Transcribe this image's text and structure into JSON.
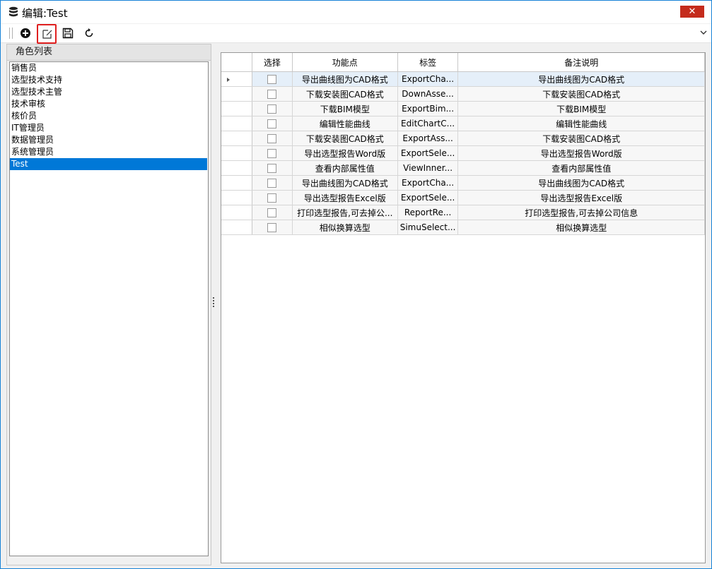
{
  "window": {
    "title": "编辑:Test",
    "icon": "database-icon",
    "close_label": "✕"
  },
  "toolbar": {
    "buttons": [
      {
        "name": "add",
        "icon": "plus-circle-icon"
      },
      {
        "name": "edit",
        "icon": "edit-icon",
        "highlighted": true
      },
      {
        "name": "save",
        "icon": "save-icon"
      },
      {
        "name": "refresh",
        "icon": "refresh-icon"
      }
    ],
    "overflow_icon": "chevron-down-icon"
  },
  "left_panel": {
    "header": "角色列表",
    "roles": [
      "销售员",
      "选型技术支持",
      "选型技术主管",
      "技术审核",
      "核价员",
      "IT管理员",
      "数据管理员",
      "系统管理员",
      "Test"
    ],
    "selected_index": 8
  },
  "grid": {
    "columns": [
      "选择",
      "功能点",
      "标签",
      "备注说明"
    ],
    "rows": [
      {
        "checked": false,
        "feature": "导出曲线图为CAD格式",
        "tag": "ExportCha...",
        "note": "导出曲线图为CAD格式"
      },
      {
        "checked": false,
        "feature": "下载安装图CAD格式",
        "tag": "DownAsse...",
        "note": "下载安装图CAD格式"
      },
      {
        "checked": false,
        "feature": "下载BIM模型",
        "tag": "ExportBim...",
        "note": "下载BIM模型"
      },
      {
        "checked": false,
        "feature": "编辑性能曲线",
        "tag": "EditChartC...",
        "note": "编辑性能曲线"
      },
      {
        "checked": false,
        "feature": "下载安装图CAD格式",
        "tag": "ExportAss...",
        "note": "下载安装图CAD格式"
      },
      {
        "checked": false,
        "feature": "导出选型报告Word版",
        "tag": "ExportSele...",
        "note": "导出选型报告Word版"
      },
      {
        "checked": false,
        "feature": "查看内部属性值",
        "tag": "ViewInner...",
        "note": "查看内部属性值"
      },
      {
        "checked": false,
        "feature": "导出曲线图为CAD格式",
        "tag": "ExportCha...",
        "note": "导出曲线图为CAD格式"
      },
      {
        "checked": false,
        "feature": "导出选型报告Excel版",
        "tag": "ExportSele...",
        "note": "导出选型报告Excel版"
      },
      {
        "checked": false,
        "feature": "打印选型报告,可去掉公...",
        "tag": "ReportRe...",
        "note": "打印选型报告,可去掉公司信息"
      },
      {
        "checked": false,
        "feature": "相似换算选型",
        "tag": "SimuSelect...",
        "note": "相似换算选型"
      }
    ],
    "current_row_index": 0
  }
}
